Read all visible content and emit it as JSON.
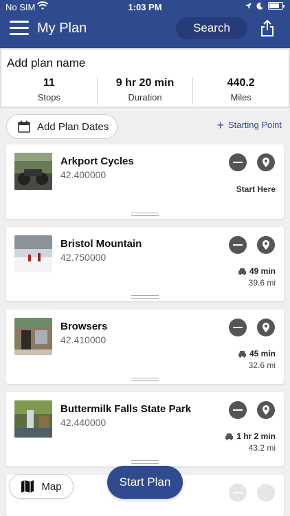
{
  "status_bar": {
    "carrier": "No SIM",
    "time": "1:03 PM"
  },
  "header": {
    "title": "My Plan",
    "search_label": "Search"
  },
  "summary": {
    "plan_name": "Add plan name",
    "stats": [
      {
        "value": "11",
        "label": "Stops"
      },
      {
        "value": "9 hr 20 min",
        "label": "Duration"
      },
      {
        "value": "440.2",
        "label": "Miles"
      }
    ]
  },
  "actions": {
    "add_dates": "Add Plan Dates",
    "starting_point": "Starting Point"
  },
  "stops": [
    {
      "name": "Arkport Cycles",
      "subtitle": "42.400000",
      "start_label": "Start Here"
    },
    {
      "name": "Bristol Mountain",
      "subtitle": "42.750000",
      "drive_time": "49 min",
      "distance": "39.6 mi"
    },
    {
      "name": "Browsers",
      "subtitle": "42.410000",
      "drive_time": "45 min",
      "distance": "32.6 mi"
    },
    {
      "name": "Buttermilk Falls State Park",
      "subtitle": "42.440000",
      "drive_time": "1 hr 2 min",
      "distance": "43.2 mi"
    }
  ],
  "bottom": {
    "map_label": "Map",
    "start_label": "Start Plan"
  },
  "colors": {
    "primary": "#2f4a8f",
    "background": "#efefef"
  }
}
